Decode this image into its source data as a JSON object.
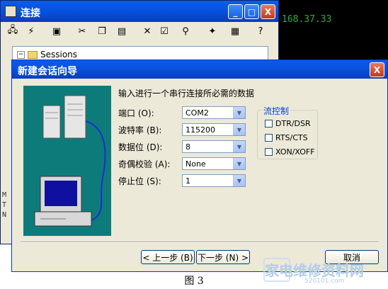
{
  "terminal": {
    "text": "168.37.33"
  },
  "bg_window": {
    "title": "连接",
    "tree_root": "Sessions",
    "caption_controls": {
      "minimize": "_",
      "maximize": "□",
      "close": "X"
    },
    "side_marks": [
      "M",
      "T",
      "N"
    ],
    "toolbar_icons": [
      "connect-icon",
      "quick-connect-icon",
      "picture-icon",
      "cut-icon",
      "copy-icon",
      "paste-icon",
      "delete-icon",
      "properties-icon",
      "find-icon",
      "new-folder-icon",
      "terminal-icon",
      "help-icon"
    ]
  },
  "dialog": {
    "title": "新建会话向导",
    "close_label": "X",
    "heading": "输入进行一个串行连接所必需的数据",
    "fields": [
      {
        "label": "端口 (O):",
        "value": "COM2"
      },
      {
        "label": "波特率 (B):",
        "value": "115200"
      },
      {
        "label": "数据位 (D):",
        "value": "8"
      },
      {
        "label": "奇偶校验 (A):",
        "value": "None"
      },
      {
        "label": "停止位 (S):",
        "value": "1"
      }
    ],
    "flow_control": {
      "title": "流控制",
      "options": [
        "DTR/DSR",
        "RTS/CTS",
        "XON/XOFF"
      ]
    },
    "buttons": {
      "back": "< 上一步 (B)",
      "next": "下一步 (N) >",
      "cancel": "取消"
    }
  },
  "caption": "图 3",
  "watermark": {
    "text": "家电维修资料网",
    "sub": "520101.com"
  },
  "colors": {
    "title_bar": "#0854e0",
    "illustration_bg": "#0e7b7b",
    "terminal_text": "#2fae3f"
  }
}
